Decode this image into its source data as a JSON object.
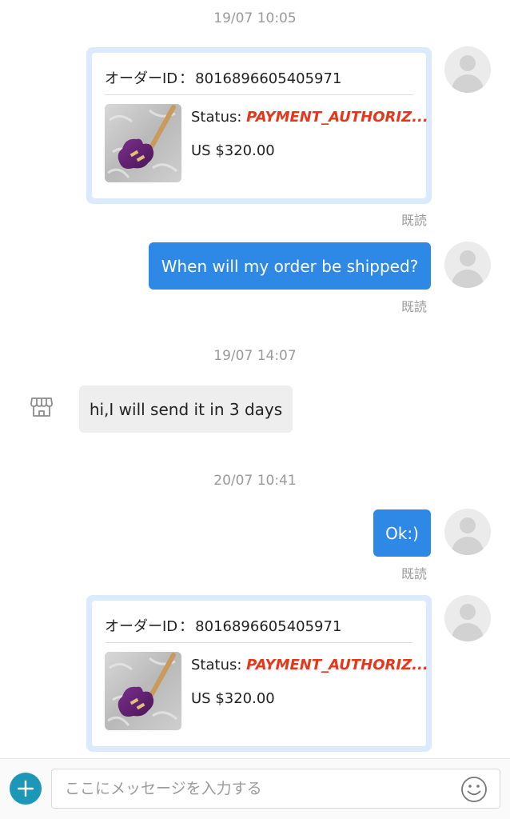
{
  "timestamps": [
    "19/07 10:05",
    "19/07 14:07",
    "20/07 10:41"
  ],
  "orders": [
    {
      "id_label": "オーダーID",
      "id_separator": "：",
      "id_value": "8016896605405971",
      "status_label": "Status: ",
      "status_value": "PAYMENT_AUTHORIZ...",
      "price": "US $320.00",
      "read": "既読"
    },
    {
      "id_label": "オーダーID",
      "id_separator": "：",
      "id_value": "8016896605405971",
      "status_label": "Status: ",
      "status_value": "PAYMENT_AUTHORIZ...",
      "price": "US $320.00"
    }
  ],
  "messages": {
    "question": {
      "text": "When will my order be shipped?",
      "read": "既読"
    },
    "seller_reply": {
      "text": "hi,I will send it in 3 days"
    },
    "ok_reply": {
      "text": "Ok:)",
      "read": "既読"
    }
  },
  "input_bar": {
    "placeholder": "ここにメッセージを入力する",
    "add_icon": "plus-icon",
    "emoji_icon": "smiley-icon"
  },
  "colors": {
    "outgoing_bubble": "#2e89e6",
    "incoming_bubble": "#eeeeee",
    "status_highlight": "#e8361a",
    "order_card_border": "#dbeafc",
    "add_button": "#1d97b7"
  }
}
